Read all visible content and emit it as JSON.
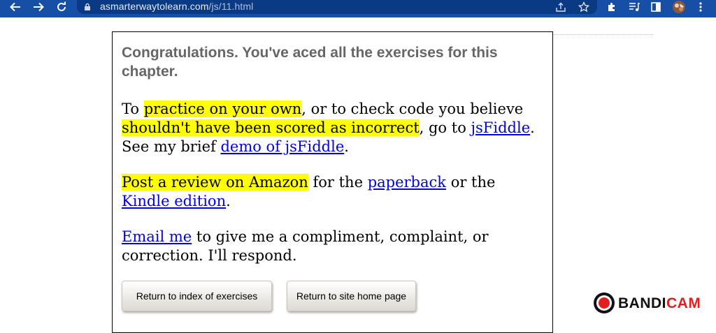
{
  "browser": {
    "url_domain": "asmarterwaytolearn.com",
    "url_path": "/js/11.html",
    "back_icon": "back-arrow-icon",
    "forward_icon": "forward-arrow-icon",
    "reload_icon": "reload-icon"
  },
  "page": {
    "congrats": "Congratulations. You've aced all the exercises for this chapter.",
    "practice": {
      "t1": "To ",
      "hl1": "practice on your own",
      "t2": ", or to check code you believe ",
      "hl2": "shouldn't have been scored as incorrect",
      "t3": ", go to ",
      "link_jsfiddle": "jsFiddle",
      "t4": ". See my brief ",
      "link_demo": "demo of jsFiddle",
      "t5": "."
    },
    "review": {
      "hl": "Post a review on Amazon",
      "t1": " for the ",
      "link_paperback": "paperback",
      "t2": " or the ",
      "link_kindle": "Kindle edition",
      "t3": "."
    },
    "email": {
      "link": "Email me",
      "t1": " to give me a compliment, complaint, or correction. I'll respond."
    },
    "buttons": {
      "index": "Return to index of exercises",
      "home": "Return to site home page"
    }
  },
  "watermark": {
    "part1": "BANDI",
    "part2": "CAM"
  },
  "colors": {
    "toolbar": "#174ea6",
    "highlight": "#ffff00",
    "link": "#0000ee",
    "heading": "#666666"
  }
}
